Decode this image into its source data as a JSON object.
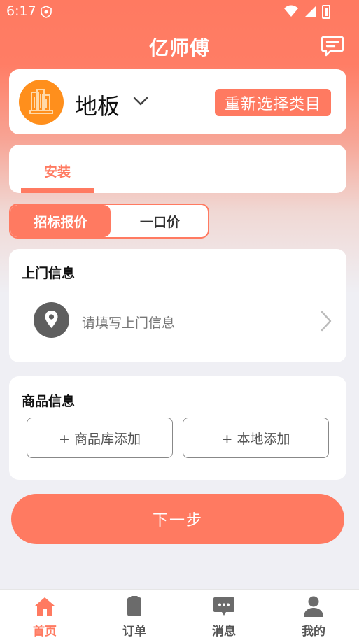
{
  "status_bar": {
    "time": "6:17"
  },
  "app": {
    "title": "亿师傅"
  },
  "category": {
    "name": "地板",
    "reselect_label": "重新选择类目"
  },
  "service_tabs": [
    {
      "label": "安装",
      "active": true
    }
  ],
  "pricing_toggle": {
    "options": [
      "招标报价",
      "一口价"
    ],
    "selected": "招标报价"
  },
  "visit_info": {
    "title": "上门信息",
    "placeholder": "请填写上门信息"
  },
  "goods_info": {
    "title": "商品信息",
    "add_from_library": "+ 商品库添加",
    "add_local": "+ 本地添加"
  },
  "next_button": {
    "label": "下一步"
  },
  "bottom_nav": [
    {
      "label": "首页",
      "icon": "home-icon",
      "active": true
    },
    {
      "label": "订单",
      "icon": "clipboard-icon",
      "active": false
    },
    {
      "label": "消息",
      "icon": "chat-bubble-icon",
      "active": false
    },
    {
      "label": "我的",
      "icon": "person-icon",
      "active": false
    }
  ],
  "colors": {
    "accent": "#ff7a61",
    "background": "#efeff4",
    "avatar": "#ff8f1c"
  }
}
